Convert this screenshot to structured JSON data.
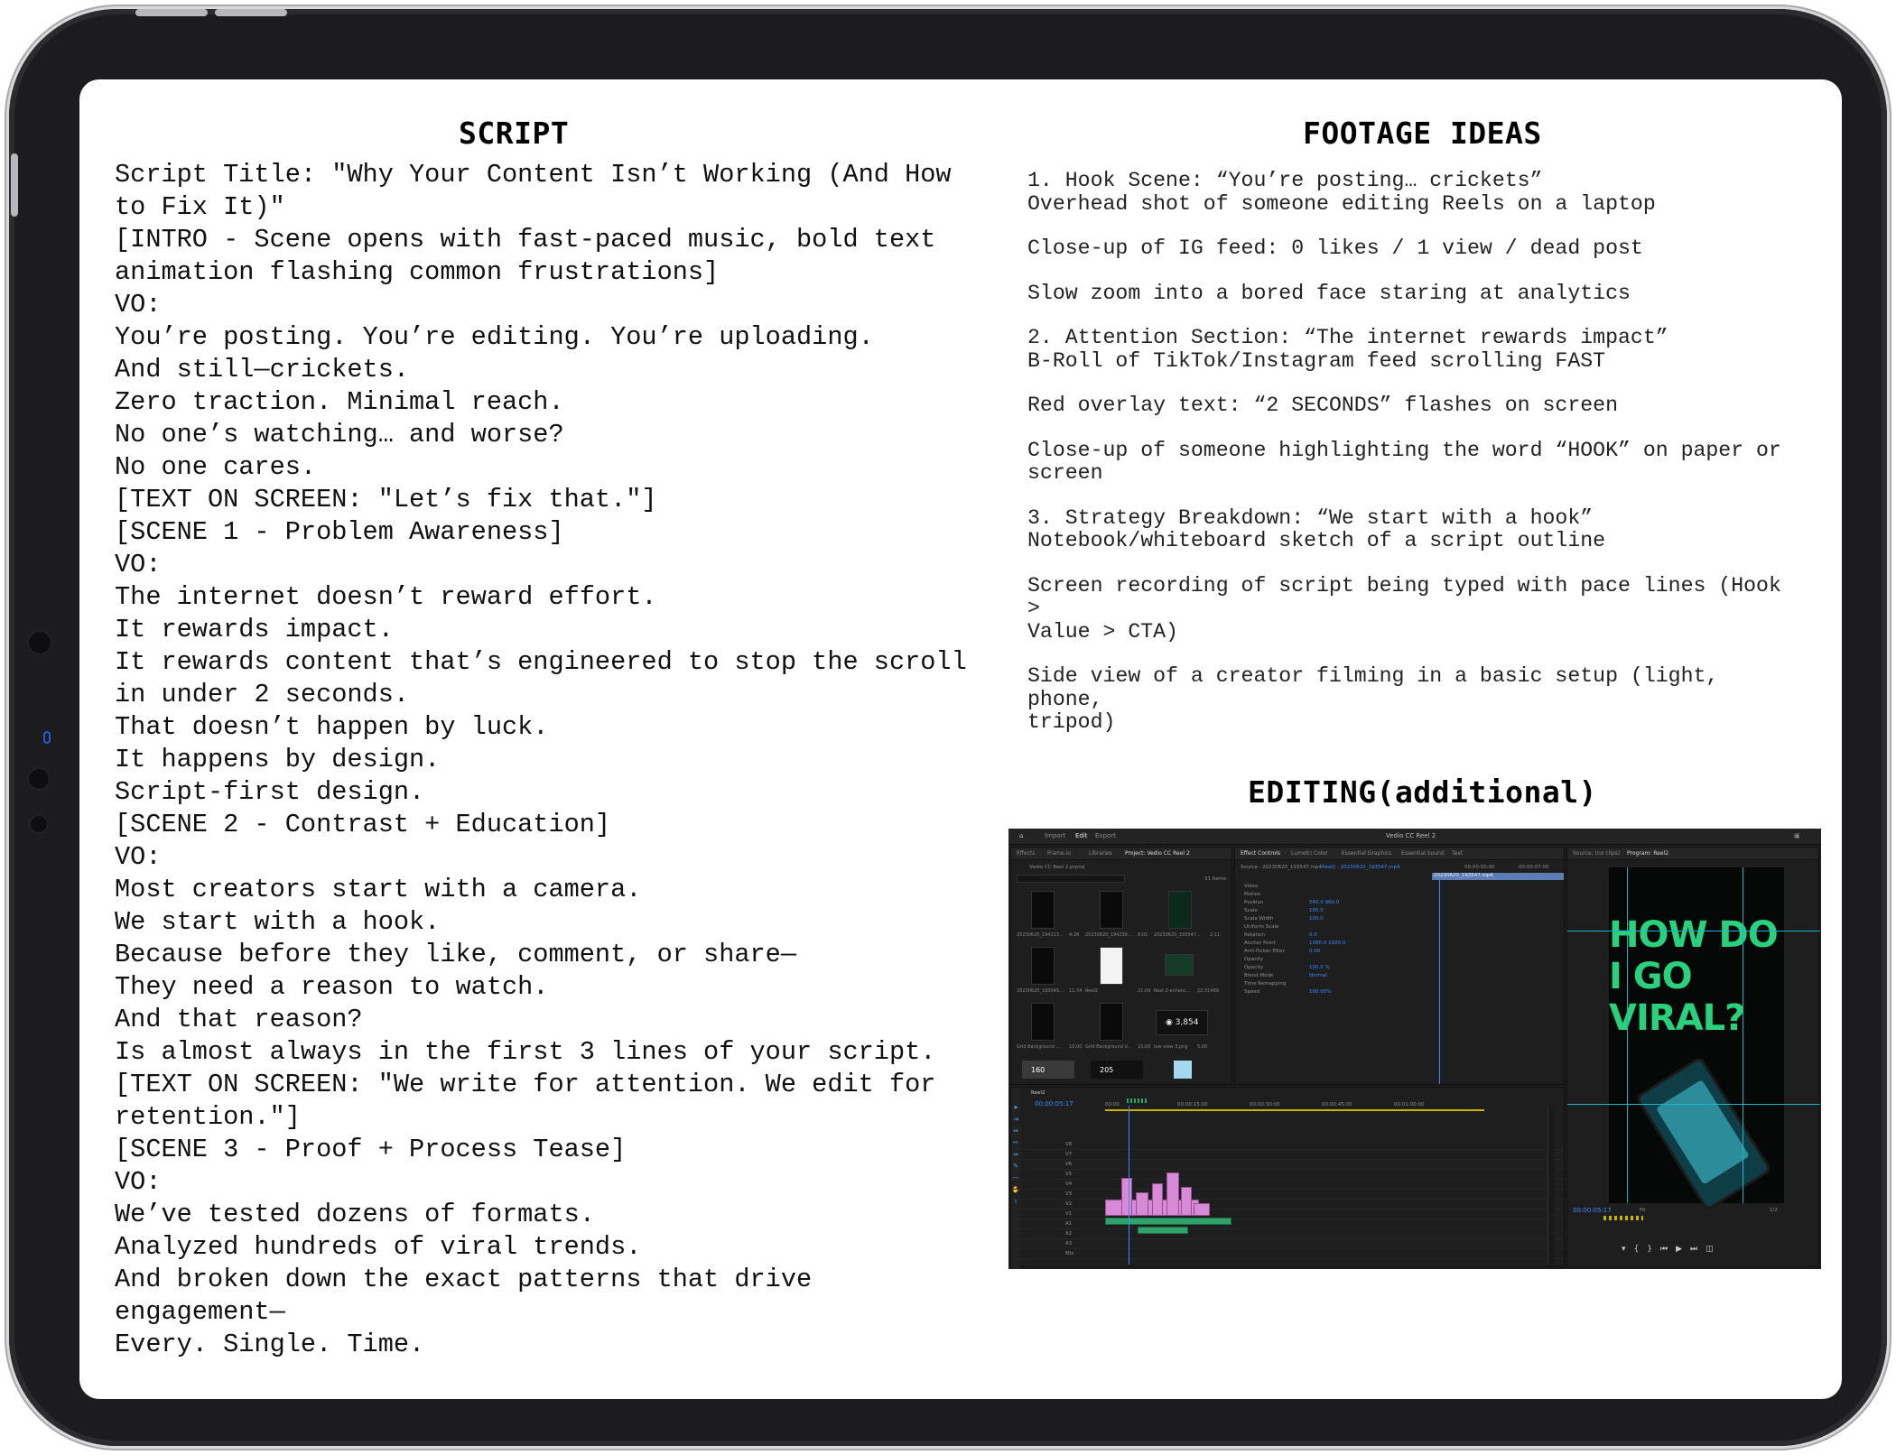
{
  "script": {
    "heading": "SCRIPT",
    "lines": [
      "Script Title: \"Why Your Content Isn’t Working (And How",
      "to Fix It)\"",
      "[INTRO - Scene opens with fast-paced music, bold text",
      "animation flashing common frustrations]",
      "VO:",
      "You’re posting. You’re editing. You’re uploading.",
      "And still—crickets.",
      "Zero traction. Minimal reach.",
      "No one’s watching… and worse?",
      "No one cares.",
      "[TEXT ON SCREEN: \"Let’s fix that.\"]",
      "[SCENE 1 - Problem Awareness]",
      "VO:",
      "The internet doesn’t reward effort.",
      "It rewards impact.",
      "It rewards content that’s engineered to stop the scroll",
      "in under 2 seconds.",
      "That doesn’t happen by luck.",
      "It happens by design.",
      "Script-first design.",
      "[SCENE 2 - Contrast + Education]",
      "VO:",
      "Most creators start with a camera.",
      "We start with a hook.",
      "Because before they like, comment, or share—",
      "They need a reason to watch.",
      "And that reason?",
      "Is almost always in the first 3 lines of your script.",
      "[TEXT ON SCREEN: \"We write for attention. We edit for",
      "retention.\"]",
      "[SCENE 3 - Proof + Process Tease]",
      "VO:",
      "We’ve tested dozens of formats.",
      "Analyzed hundreds of viral trends.",
      "And broken down the exact patterns that drive",
      "engagement—",
      "Every. Single. Time."
    ]
  },
  "footage": {
    "heading": "FOOTAGE IDEAS",
    "groups": [
      [
        "1. Hook Scene: “You’re posting… crickets”",
        "Overhead shot of someone editing Reels on a laptop"
      ],
      [
        "Close-up of IG feed: 0 likes / 1 view / dead post"
      ],
      [
        "Slow zoom into a bored face staring at analytics"
      ],
      [
        "2. Attention Section: “The internet rewards impact”",
        "B-Roll of TikTok/Instagram feed scrolling FAST"
      ],
      [
        "Red overlay text: “2 SECONDS” flashes on screen"
      ],
      [
        "Close-up of someone highlighting the word “HOOK” on paper or",
        "screen"
      ],
      [
        "3. Strategy Breakdown: “We start with a hook”",
        "Notebook/whiteboard sketch of a script outline"
      ],
      [
        "Screen recording of script being typed with pace lines (Hook >",
        "Value > CTA)"
      ],
      [
        "Side view of a creator filming in a basic setup (light, phone,",
        "tripod)"
      ]
    ]
  },
  "editing": {
    "heading": "EDITING(additional)",
    "window_title": "Vedio CC Reel 2",
    "workspace_tabs": [
      "Import",
      "Edit",
      "Export"
    ],
    "project_tabs": [
      "Effects",
      "Frame.io",
      "Libraries",
      "Project: Vedio CC Reel 2"
    ],
    "project_file": "Vedio CC Reel 2.prproj",
    "items_count": "31 Items",
    "thumbs": [
      {
        "name": "20230620_194213...",
        "dur": "4:28"
      },
      {
        "name": "20230620_194236...",
        "dur": "8:01"
      },
      {
        "name": "20230620_193547...",
        "dur": "2:11"
      },
      {
        "name": "20230620_193045...",
        "dur": "11:34"
      },
      {
        "name": "Reel2",
        "dur": "21:09"
      },
      {
        "name": "Reel 2-enhanc...",
        "dur": "22:31489"
      },
      {
        "name": "Grid Background ...",
        "dur": "10:00"
      },
      {
        "name": "Grid Background V...",
        "dur": "10:00"
      },
      {
        "name": "low view 3.png",
        "dur": "5:00"
      }
    ],
    "view_count_big": "3,854",
    "effect_tabs": [
      "Effect Controls",
      "Lumetri Color",
      "Essential Graphics",
      "Essential Sound",
      "Text"
    ],
    "source_label": "Source · 20230620_193547.mp4",
    "source_clip": "Reel2 · 20230620_193547.mp4",
    "timecode_a": "00:00:00:00",
    "timecode_b": "00:00:07:00",
    "clip_label": "20230620_193547.mp4",
    "props": [
      {
        "name": "Video",
        "val": ""
      },
      {
        "name": "Motion",
        "val": ""
      },
      {
        "name": "Position",
        "val": "540.0    960.0"
      },
      {
        "name": "Scale",
        "val": "100.0"
      },
      {
        "name": "Scale Width",
        "val": "100.0"
      },
      {
        "name": "Uniform Scale",
        "val": ""
      },
      {
        "name": "Rotation",
        "val": "0.0"
      },
      {
        "name": "Anchor Point",
        "val": "1080.0    1920.0"
      },
      {
        "name": "Anti-flicker Filter",
        "val": "0.00"
      },
      {
        "name": "Opacity",
        "val": ""
      },
      {
        "name": "Opacity",
        "val": "100.0 %"
      },
      {
        "name": "Blend Mode",
        "val": "Normal"
      },
      {
        "name": "Time Remapping",
        "val": ""
      },
      {
        "name": "Speed",
        "val": "100.00%"
      }
    ],
    "program_tabs": [
      "Source: (no clips)",
      "Program: Reel2"
    ],
    "viral_text": "HOW DO\nI GO\nVIRAL?",
    "program_timecode": "00:00:05:17",
    "fit_label": "Fit",
    "ratio_label": "1/2",
    "timeline_tab": "Reel2",
    "timeline_timecode": "00:00:05:17",
    "ruler": [
      "00:00",
      "00:00:15:00",
      "00:00:30:00",
      "00:00:45:00",
      "00:01:00:00"
    ],
    "tracks": [
      "V8",
      "V7",
      "V6",
      "V5",
      "V4",
      "V3",
      "V2",
      "V1",
      "A1",
      "A2",
      "A3",
      "Mix"
    ],
    "mix_value": "0.0",
    "preview_number": "160",
    "preview_number_b": "205",
    "lower_timecode": "00:00:05:17"
  },
  "colors": {
    "frame": "#1c1c1e",
    "accent_green": "#29d17d",
    "clip_pink": "#d78ad6",
    "timecode_blue": "#3d8bff",
    "guide_cyan": "#19b7c7"
  }
}
